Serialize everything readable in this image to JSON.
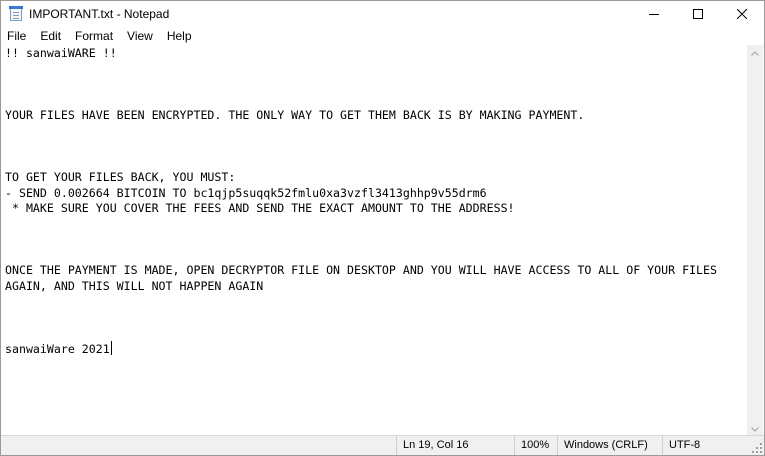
{
  "window": {
    "title": "IMPORTANT.txt - Notepad",
    "controls": {
      "minimize": "minimize-icon",
      "maximize": "maximize-icon",
      "close": "close-icon"
    }
  },
  "menu": {
    "items": [
      "File",
      "Edit",
      "Format",
      "View",
      "Help"
    ]
  },
  "document": {
    "lines": [
      "!! sanwaiWARE !!",
      "",
      "",
      "",
      "YOUR FILES HAVE BEEN ENCRYPTED. THE ONLY WAY TO GET THEM BACK IS BY MAKING PAYMENT.",
      "",
      "",
      "",
      "TO GET YOUR FILES BACK, YOU MUST:",
      "- SEND 0.002664 BITCOIN TO bc1qjp5suqqk52fmlu0xa3vzfl3413ghhp9v55drm6",
      " * MAKE SURE YOU COVER THE FEES AND SEND THE EXACT AMOUNT TO THE ADDRESS!",
      "",
      "",
      "",
      "ONCE THE PAYMENT IS MADE, OPEN DECRYPTOR FILE ON DESKTOP AND YOU WILL HAVE ACCESS TO ALL OF YOUR FILES",
      "AGAIN, AND THIS WILL NOT HAPPEN AGAIN",
      "",
      "",
      "",
      "sanwaiWare 2021"
    ]
  },
  "status": {
    "position": "Ln 19, Col 16",
    "zoom": "100%",
    "line_endings": "Windows (CRLF)",
    "encoding": "UTF-8"
  }
}
